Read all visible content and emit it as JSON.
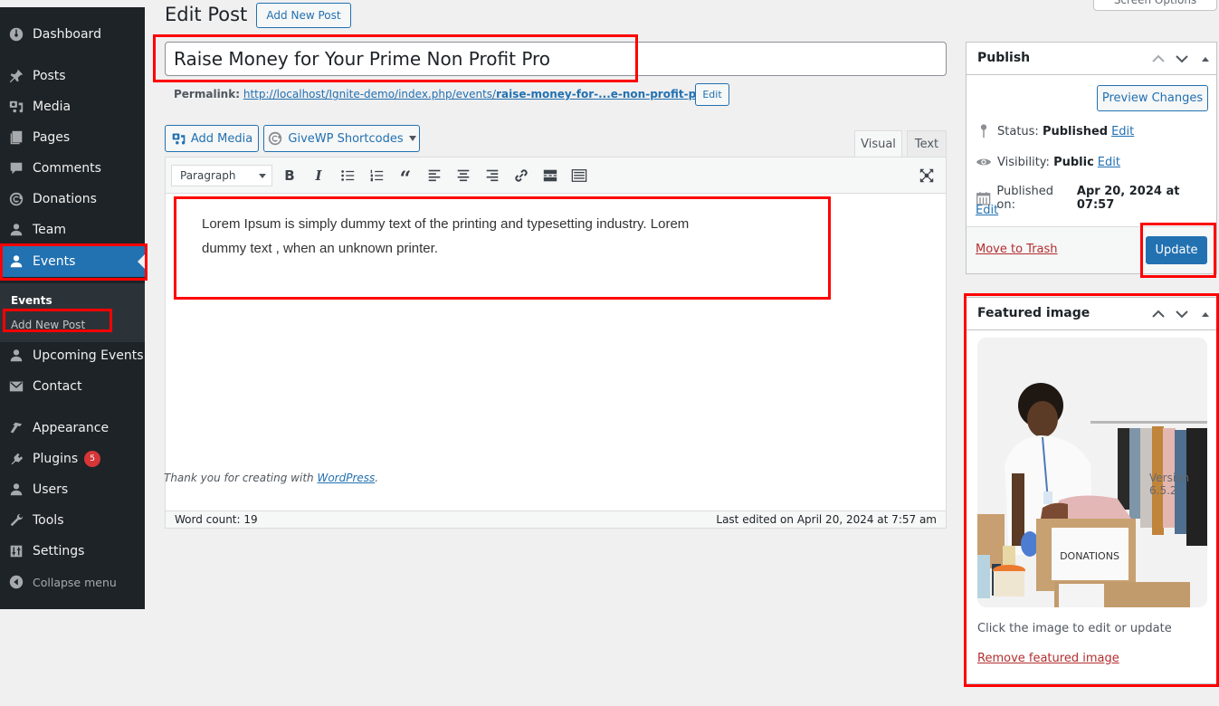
{
  "sidebar": {
    "items": [
      {
        "label": "Dashboard",
        "icon": "dashboard-icon"
      },
      {
        "label": "Posts",
        "icon": "pin-icon"
      },
      {
        "label": "Media",
        "icon": "media-icon"
      },
      {
        "label": "Pages",
        "icon": "pages-icon"
      },
      {
        "label": "Comments",
        "icon": "comment-icon"
      },
      {
        "label": "Donations",
        "icon": "givewp-icon"
      },
      {
        "label": "Team",
        "icon": "user-icon"
      },
      {
        "label": "Events",
        "icon": "user-icon",
        "active": true
      },
      {
        "label": "Upcoming Events",
        "icon": "user-icon"
      },
      {
        "label": "Contact",
        "icon": "mail-icon"
      },
      {
        "label": "Appearance",
        "icon": "brush-icon"
      },
      {
        "label": "Plugins",
        "icon": "plugin-icon",
        "badge": "5"
      },
      {
        "label": "Users",
        "icon": "user-icon"
      },
      {
        "label": "Tools",
        "icon": "wrench-icon"
      },
      {
        "label": "Settings",
        "icon": "sliders-icon"
      },
      {
        "label": "Collapse menu",
        "icon": "collapse-icon"
      }
    ],
    "submenu": {
      "title": "Events",
      "item": "Add New Post"
    }
  },
  "header": {
    "title": "Edit Post",
    "add_new_label": "Add New Post",
    "screen_options": "Screen Options"
  },
  "post": {
    "title": "Raise Money for Your Prime Non Profit Pro",
    "permalink_label": "Permalink:",
    "permalink_base": "http://localhost/Ignite-demo/index.php/events/",
    "permalink_slug": "raise-money-for-...e-non-profit-pro",
    "permalink_trail": "/",
    "permalink_edit": "Edit"
  },
  "editor": {
    "add_media": "Add Media",
    "givewp": "GiveWP Shortcodes",
    "tab_visual": "Visual",
    "tab_text": "Text",
    "format": "Paragraph",
    "content_line1": "Lorem Ipsum is simply dummy text of the printing and typesetting industry. Lorem",
    "content_line2": "dummy text , when an unknown printer.",
    "word_count": "Word count: 19",
    "last_edited": "Last edited on April 20, 2024 at 7:57 am"
  },
  "footer": {
    "thanks_prefix": "Thank you for creating with ",
    "thanks_link": "WordPress",
    "thanks_suffix": ".",
    "version": "Version 6.5.2"
  },
  "publish": {
    "title": "Publish",
    "preview": "Preview Changes",
    "status_label": "Status:",
    "status_value": "Published",
    "visibility_label": "Visibility:",
    "visibility_value": "Public",
    "published_label": "Published on:",
    "published_value": "Apr 20, 2024 at 07:57",
    "edit": "Edit",
    "trash": "Move to Trash",
    "update": "Update"
  },
  "featured": {
    "title": "Featured image",
    "image_alt": "DONATIONS",
    "hint": "Click the image to edit or update",
    "remove": "Remove featured image"
  },
  "colors": {
    "accent": "#2271b1",
    "sidebar_bg": "#1d2327",
    "danger": "#b32d2e",
    "highlight": "#ff0000"
  }
}
